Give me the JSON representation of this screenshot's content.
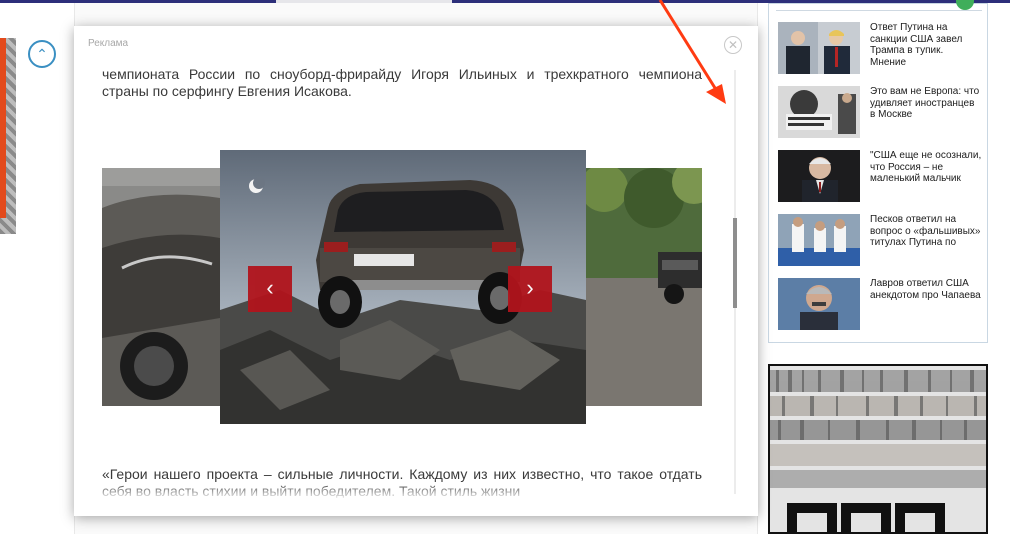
{
  "modal": {
    "label": "Реклама",
    "close_icon": "close-icon",
    "text_top": "чемпионата России по сноуборд-фрирайду Игоря Ильиных и трехкратного чемпиона страны по серфингу Евгения Исакова.",
    "text_bottom": "«Герои нашего проекта – сильные личности. Каждому из них известно, что такое отдать себя во власть стихии и выйти победителем. Такой стиль жизни",
    "gallery": {
      "prev_icon": "chevron-left-icon",
      "next_icon": "chevron-right-icon",
      "prev_glyph": "‹",
      "next_glyph": "›"
    }
  },
  "left": {
    "scroll_up_icon": "chevron-up-icon",
    "scroll_up_glyph": "⌃"
  },
  "news": [
    {
      "text": "Ответ Путина на санкции США завел Трампа в тупик. Мнение"
    },
    {
      "text": "Это вам не Европа: что удивляет иностранцев в Москве"
    },
    {
      "text": "\"США еще не осознали, что Россия – не маленький мальчик"
    },
    {
      "text": "Песков ответил на вопрос о «фальшивых» титулах Путина по"
    },
    {
      "text": "Лавров ответил США анекдотом про Чапаева"
    }
  ],
  "colors": {
    "accent_red": "#b1141c",
    "annotation_arrow": "#ff3b12",
    "brand_navy": "#2d2f7a",
    "link_blue": "#3a8fc2"
  }
}
